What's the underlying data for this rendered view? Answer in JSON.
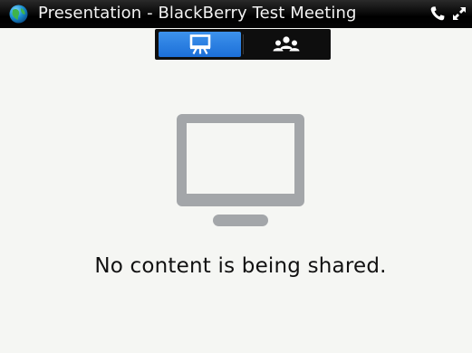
{
  "window": {
    "title": "Presentation - BlackBerry Test Meeting",
    "app_icon": "globe-icon",
    "actions": [
      {
        "name": "phone-icon"
      },
      {
        "name": "expand-icon"
      }
    ]
  },
  "tabs": [
    {
      "name": "presentation",
      "icon": "presentation-easel-icon",
      "selected": true
    },
    {
      "name": "attendees",
      "icon": "attendees-icon",
      "selected": false
    }
  ],
  "main": {
    "illustration": "monitor-icon",
    "empty_message": "No content is being shared."
  },
  "colors": {
    "titlebar": "#000000",
    "selected_tab": "#2a7fe3",
    "background": "#f5f6f3",
    "monitor": "#a3a6a9"
  }
}
